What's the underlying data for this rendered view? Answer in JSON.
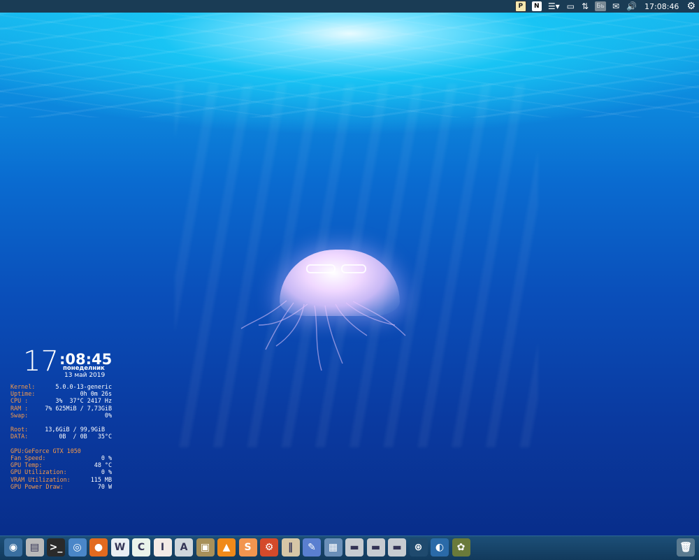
{
  "top_panel": {
    "tray": [
      {
        "icon": "pidgin-p-icon",
        "glyph": "P"
      },
      {
        "icon": "notion-n-icon",
        "glyph": "N"
      },
      {
        "icon": "menu-list-icon",
        "glyph": "☰▾"
      },
      {
        "icon": "clipboard-icon",
        "glyph": "▭"
      },
      {
        "icon": "network-arrows-icon",
        "glyph": "⇅"
      },
      {
        "icon": "keyboard-layout-icon",
        "glyph": "Бь"
      },
      {
        "icon": "mail-icon",
        "glyph": "✉"
      },
      {
        "icon": "volume-icon",
        "glyph": "🔊"
      }
    ],
    "clock": "17:08:46",
    "settings_icon": "gear-icon"
  },
  "conky": {
    "hour": "17",
    "minsec": ":08:45",
    "weekday": "понеделник",
    "date": "13 май 2019",
    "system": [
      {
        "label": "Kernel:",
        "value": "5.0.0-13-generic"
      },
      {
        "label": "Uptime:",
        "value": "0h 0m 26s"
      },
      {
        "label": "CPU :",
        "value": "3%  37°C 2417 Hz"
      },
      {
        "label": "RAM :",
        "value": "7% 625MiB / 7,73GiB"
      },
      {
        "label": "Swap:",
        "value": "0%"
      }
    ],
    "disks": [
      {
        "label": "Root:",
        "value": "13,6GiB / 99,9GiB"
      },
      {
        "label": "DATA:",
        "value": "0B  / 0B   35°C"
      }
    ],
    "gpu_label": "GPU:",
    "gpu_name": "GeForce GTX 1050",
    "gpu": [
      {
        "label": "Fan Speed:",
        "value": "0 %"
      },
      {
        "label": "GPU Temp:",
        "value": "48 °C"
      },
      {
        "label": "GPU Utilization:",
        "value": "0 %"
      },
      {
        "label": "VRAM Utilization:",
        "value": "115 MB"
      },
      {
        "label": "GPU Power Draw:",
        "value": "70 W"
      }
    ]
  },
  "dock": {
    "apps": [
      {
        "name": "ubuntu-menu-icon",
        "glyph": "◉",
        "bg": "#3a6fa0"
      },
      {
        "name": "file-manager-icon",
        "glyph": "▤",
        "bg": "#b9b9b9"
      },
      {
        "name": "terminal-icon",
        "glyph": ">_",
        "bg": "#2a2a2a"
      },
      {
        "name": "chromium-icon",
        "glyph": "◎",
        "bg": "#4a86c8"
      },
      {
        "name": "firefox-icon",
        "glyph": "●",
        "bg": "#e26a1f"
      },
      {
        "name": "writer-icon",
        "glyph": "W",
        "bg": "#e9eef3"
      },
      {
        "name": "calc-icon",
        "glyph": "C",
        "bg": "#e9f3ea"
      },
      {
        "name": "impress-icon",
        "glyph": "I",
        "bg": "#f3ebe6"
      },
      {
        "name": "software-icon",
        "glyph": "A",
        "bg": "#cfd6dc"
      },
      {
        "name": "archive-icon",
        "glyph": "▣",
        "bg": "#a7905a"
      },
      {
        "name": "vlc-icon",
        "glyph": "▲",
        "bg": "#f08a1a"
      },
      {
        "name": "sublime-icon",
        "glyph": "S",
        "bg": "#f2954f"
      },
      {
        "name": "settings-app-icon",
        "glyph": "⚙",
        "bg": "#d44a2a"
      },
      {
        "name": "books-icon",
        "glyph": "‖",
        "bg": "#d6c6a6"
      },
      {
        "name": "pencils-icon",
        "glyph": "✎",
        "bg": "#5a7fd0"
      },
      {
        "name": "screenshot-icon",
        "glyph": "▦",
        "bg": "#6a8fb8"
      },
      {
        "name": "drive-icon-1",
        "glyph": "▬",
        "bg": "#c7ccd1"
      },
      {
        "name": "drive-icon-2",
        "glyph": "▬",
        "bg": "#c7ccd1"
      },
      {
        "name": "drive-icon-3",
        "glyph": "▬",
        "bg": "#c7ccd1"
      },
      {
        "name": "steam-icon",
        "glyph": "⊛",
        "bg": "#1f4a6e"
      },
      {
        "name": "monitor-icon",
        "glyph": "◐",
        "bg": "#2a6aa8"
      },
      {
        "name": "game-icon",
        "glyph": "✿",
        "bg": "#6a7a3a"
      }
    ],
    "trash": {
      "name": "trash-icon",
      "glyph": "🗑",
      "bg": "#5a7a90"
    }
  },
  "colors": {
    "panel_bg": "#1a3c55",
    "conky_label": "#f59a4a",
    "conky_value": "#ffffff"
  }
}
